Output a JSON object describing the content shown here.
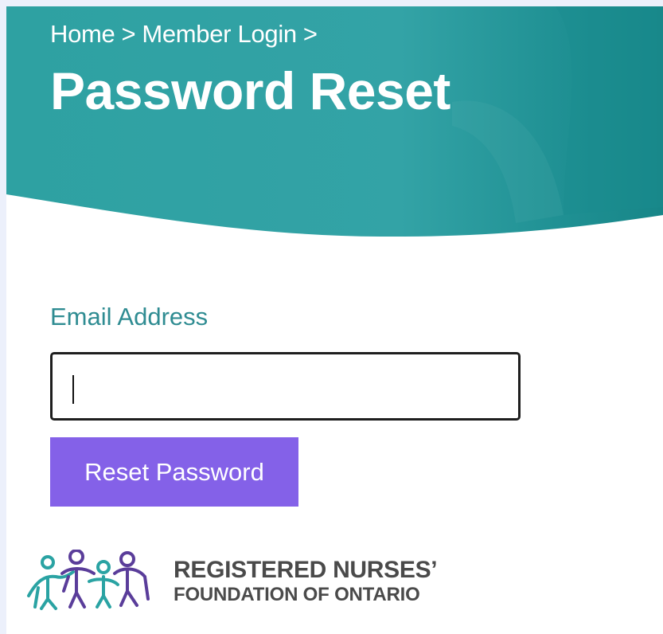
{
  "breadcrumb": {
    "home": "Home",
    "sep1": ">",
    "member_login": "Member Login",
    "sep2": ">"
  },
  "page_title": "Password Reset",
  "form": {
    "email_label": "Email Address",
    "email_value": "",
    "submit_label": "Reset Password"
  },
  "logo": {
    "line1": "REGISTERED NURSES’",
    "line2": "FOUNDATION OF ONTARIO"
  },
  "colors": {
    "hero_teal": "#2f9ea0",
    "label_teal": "#2f8c92",
    "button_purple": "#8461e8",
    "logo_purple": "#5a3d9a"
  }
}
